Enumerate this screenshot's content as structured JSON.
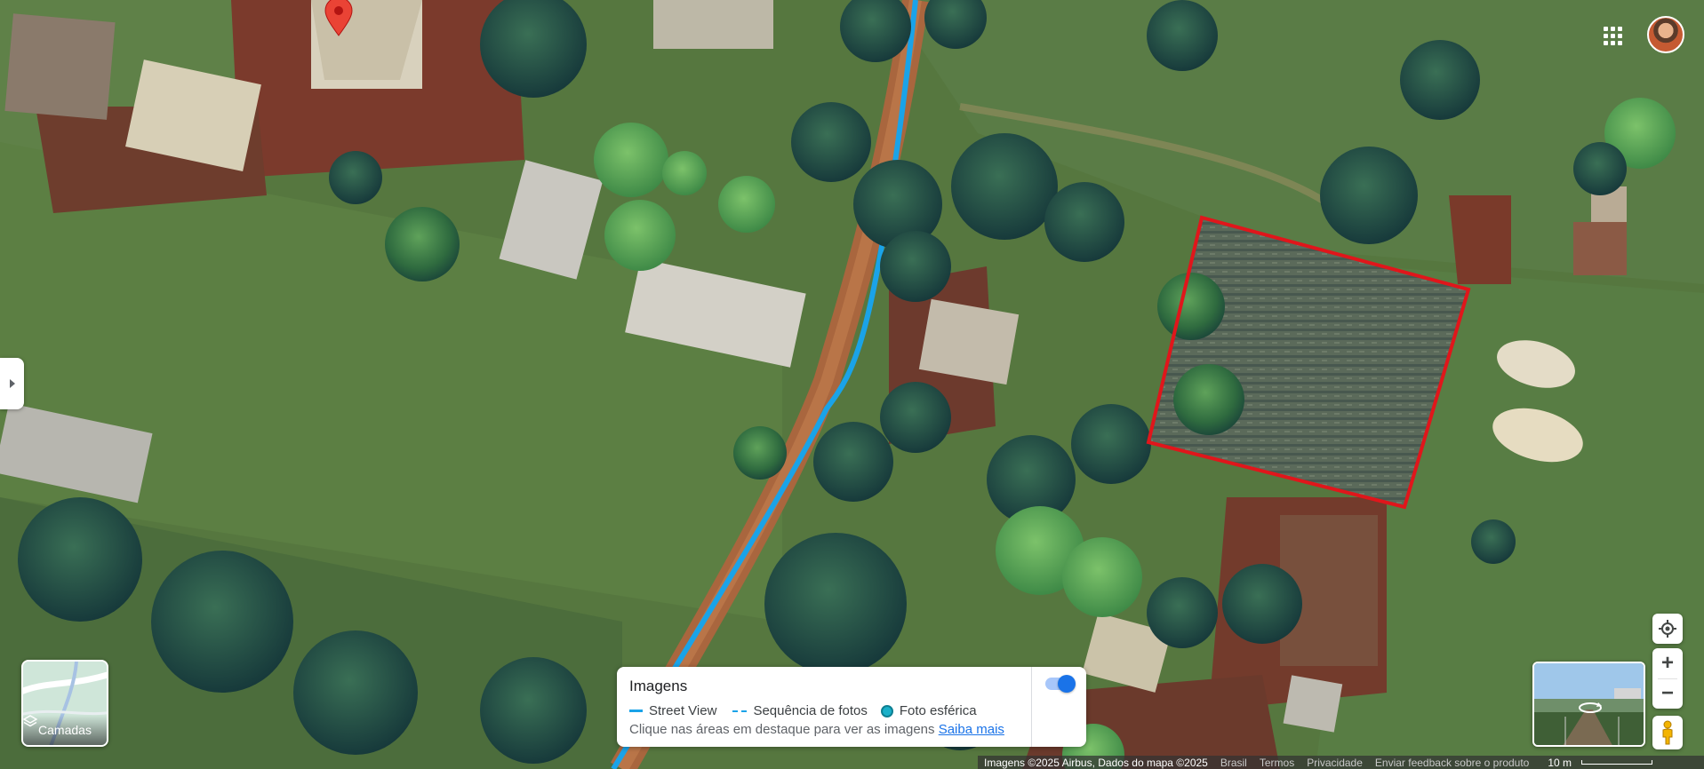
{
  "map": {
    "type": "satellite",
    "highlight_color": "#e0161b",
    "street_view_color": "#1aa3e8",
    "pin_color": "#ea4335"
  },
  "layers_button": {
    "label": "Camadas",
    "icon": "layers-icon"
  },
  "imagery_card": {
    "title": "Imagens",
    "toggle_on": true,
    "legend": [
      {
        "icon": "street-view-line",
        "label": "Street View"
      },
      {
        "icon": "photo-sequence-dashed-line",
        "label": "Sequência de fotos"
      },
      {
        "icon": "spherical-photo-dot",
        "label": "Foto esférica"
      }
    ],
    "hint": "Clique nas áreas em destaque para ver as imagens",
    "learn_more": "Saiba mais"
  },
  "controls": {
    "apps_icon": "apps-grid-icon",
    "avatar_icon": "account-avatar",
    "location_icon": "my-location-icon",
    "zoom_in": "+",
    "zoom_out": "−",
    "pegman_icon": "pegman-icon"
  },
  "attribution": {
    "imagery": "Imagens ©2025 Airbus, Dados do mapa ©2025",
    "country": "Brasil",
    "terms": "Termos",
    "privacy": "Privacidade",
    "feedback": "Enviar feedback sobre o produto",
    "scale": "10 m"
  }
}
